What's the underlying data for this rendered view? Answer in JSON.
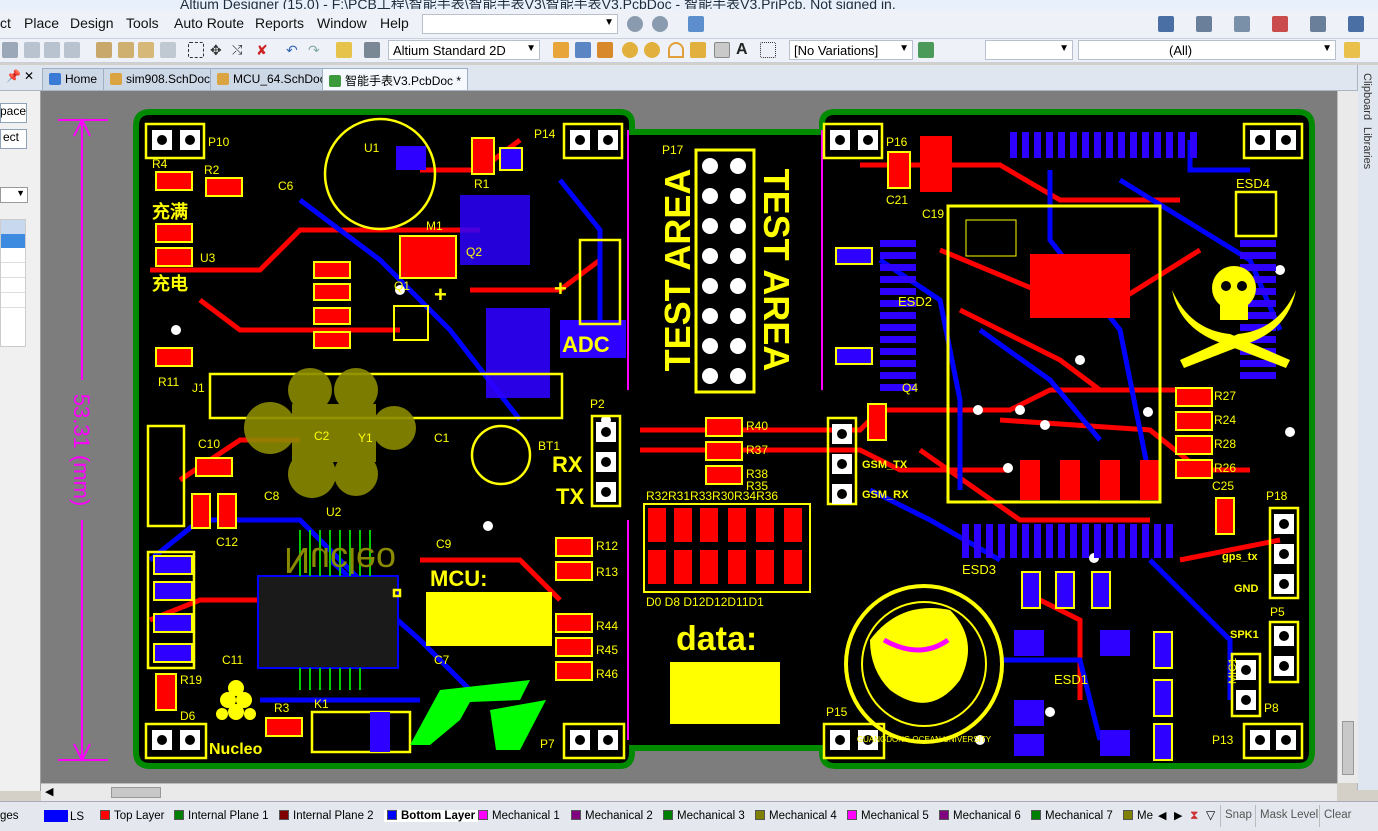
{
  "window": {
    "title": "Altium Designer (15.0) - F:\\PCB工程\\智能手表\\智能手表V3\\智能手表V3.PcbDoc - 智能手表V3.PrjPcb. Not signed in."
  },
  "menu": [
    "ct",
    "Place",
    "Design",
    "Tools",
    "Auto Route",
    "Reports",
    "Window",
    "Help"
  ],
  "toolbar": {
    "view_mode": "Altium Standard 2D",
    "variations": "[No Variations]",
    "filter_blank": "",
    "filter_all": "(All)"
  },
  "left_panel": {
    "pin_icon": "pin-icon",
    "buttons": [
      "pace",
      "ect"
    ]
  },
  "tabs": [
    {
      "label": "Home",
      "icon": "home-icon",
      "color": "#3a7bd5"
    },
    {
      "label": "sim908.SchDoc",
      "icon": "schematic-icon",
      "color": "#d9a441"
    },
    {
      "label": "MCU_64.SchDoc",
      "icon": "schematic-icon",
      "color": "#d9a441"
    },
    {
      "label": "智能手表V3.PcbDoc *",
      "icon": "pcb-icon",
      "color": "#3c9a3c"
    }
  ],
  "right_panel": [
    "Clipboard",
    "Libraries"
  ],
  "board": {
    "dimension_label": "53.31 (mm)",
    "test_area": "TEST AREA",
    "adc": "ADC",
    "rx": "RX",
    "tx": "TX",
    "mcu": "MCU:",
    "data": "data:",
    "nucleo_big": "Nucleo",
    "nucleo_small": "Nucleo",
    "charge_full": "充满",
    "charging": "充电",
    "gsm_tx": "GSM_TX",
    "gsm_rx": "GSM_RX",
    "gps_tx": "gps_tx",
    "gnd": "GND",
    "spk": "SPK1",
    "esd1": "ESD1",
    "esd2": "ESD2",
    "esd3": "ESD3",
    "esd4": "ESD4",
    "university": "GUANGDONG OCEAN UNIVERSITY",
    "data_bits": "D0 D8 D12D12D11D1",
    "res_row": "R32R31R33R30R34R36",
    "designators": [
      "P10",
      "P14",
      "P17",
      "P16",
      "P18",
      "P15",
      "P13",
      "P8",
      "P7",
      "P2",
      "P5",
      "R4",
      "R2",
      "R1",
      "R11",
      "R27",
      "R24",
      "R28",
      "R26",
      "R40",
      "R37",
      "R38",
      "R35",
      "R12",
      "R13",
      "R44",
      "R45",
      "R46",
      "R19",
      "R3",
      "C1",
      "C2",
      "C6",
      "C7",
      "C8",
      "C9",
      "C10",
      "C11",
      "C12",
      "C21",
      "C19",
      "C25",
      "Q1",
      "Q2",
      "Q4",
      "U1",
      "U2",
      "J1",
      "M1",
      "K1",
      "BT1",
      "D6",
      "Y1",
      "MIC1",
      "U3"
    ]
  },
  "layers": [
    {
      "name": "LS",
      "color": "#0000ff"
    },
    {
      "name": "Top Layer",
      "color": "#ff0000"
    },
    {
      "name": "Internal Plane 1",
      "color": "#008000"
    },
    {
      "name": "Internal Plane 2",
      "color": "#800000"
    },
    {
      "name": "Bottom Layer",
      "color": "#0000ff"
    },
    {
      "name": "Mechanical 1",
      "color": "#ff00ff"
    },
    {
      "name": "Mechanical 2",
      "color": "#800080"
    },
    {
      "name": "Mechanical 3",
      "color": "#008000"
    },
    {
      "name": "Mechanical 4",
      "color": "#808000"
    },
    {
      "name": "Mechanical 5",
      "color": "#ff00ff"
    },
    {
      "name": "Mechanical 6",
      "color": "#800080"
    },
    {
      "name": "Mechanical 7",
      "color": "#008000"
    },
    {
      "name": "Me",
      "color": "#808000"
    }
  ],
  "layer_bar_buttons": [
    "Snap",
    "Mask Level",
    "Clear"
  ],
  "left_status": "ges"
}
